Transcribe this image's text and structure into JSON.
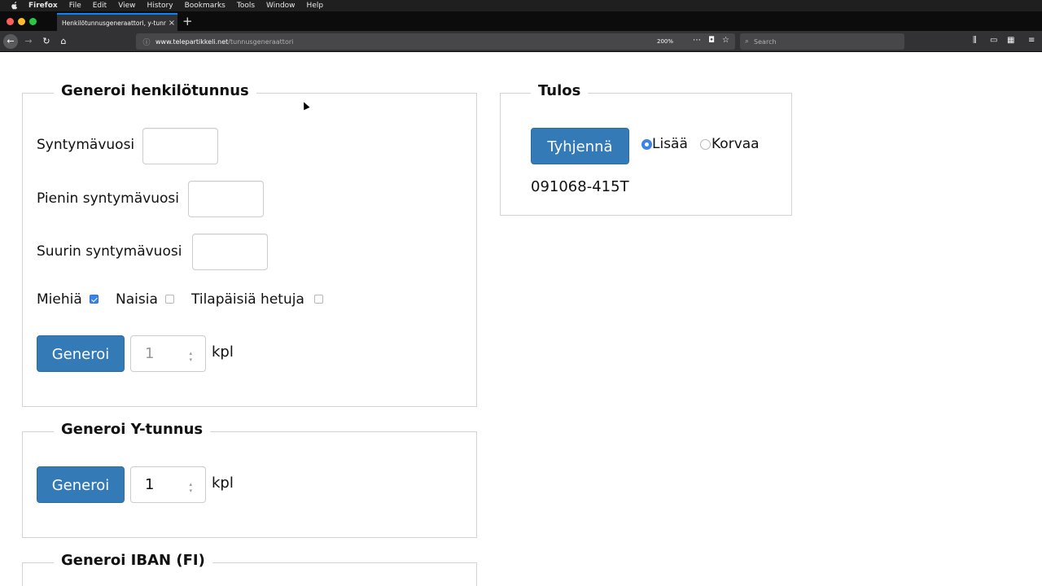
{
  "menubar": {
    "app": "Firefox",
    "items": [
      "File",
      "Edit",
      "View",
      "History",
      "Bookmarks",
      "Tools",
      "Window",
      "Help"
    ]
  },
  "tab": {
    "title": "Henkilötunnusgeneraattori, y-tunnu",
    "close": "×",
    "new_tab": "+"
  },
  "navbar": {
    "back": "←",
    "forward": "→",
    "reload": "↻",
    "home": "⌂",
    "url_host": "www.telepartikkeli.net",
    "url_path": "/tunnusgeneraattori",
    "zoom": "200%",
    "search_placeholder": "Search"
  },
  "henkilotunnus": {
    "legend": "Generoi henkilötunnus",
    "syntymavuosi_label": "Syntymävuosi",
    "syntymavuosi_value": "",
    "pienin_label": "Pienin syntymävuosi",
    "pienin_value": "",
    "suurin_label": "Suurin syntymävuosi",
    "suurin_value": "",
    "miehia_label": "Miehiä",
    "miehia_checked": true,
    "naisia_label": "Naisia",
    "naisia_checked": false,
    "tilapaisia_label": "Tilapäisiä hetuja",
    "tilapaisia_checked": false,
    "generoi_button": "Generoi",
    "count_value": "1",
    "unit": "kpl"
  },
  "ytunnus": {
    "legend": "Generoi Y-tunnus",
    "generoi_button": "Generoi",
    "count_value": "1",
    "unit": "kpl"
  },
  "iban": {
    "legend": "Generoi IBAN (FI)"
  },
  "tulos": {
    "legend": "Tulos",
    "tyhjenna_button": "Tyhjennä",
    "lisaa_label": "Lisää",
    "lisaa_selected": true,
    "korvaa_label": "Korvaa",
    "korvaa_selected": false,
    "result_value": "091068-415T"
  },
  "colors": {
    "primary_button": "#337ab7",
    "checkbox_accent": "#3a84e9",
    "tab_accent": "#0a84ff"
  }
}
